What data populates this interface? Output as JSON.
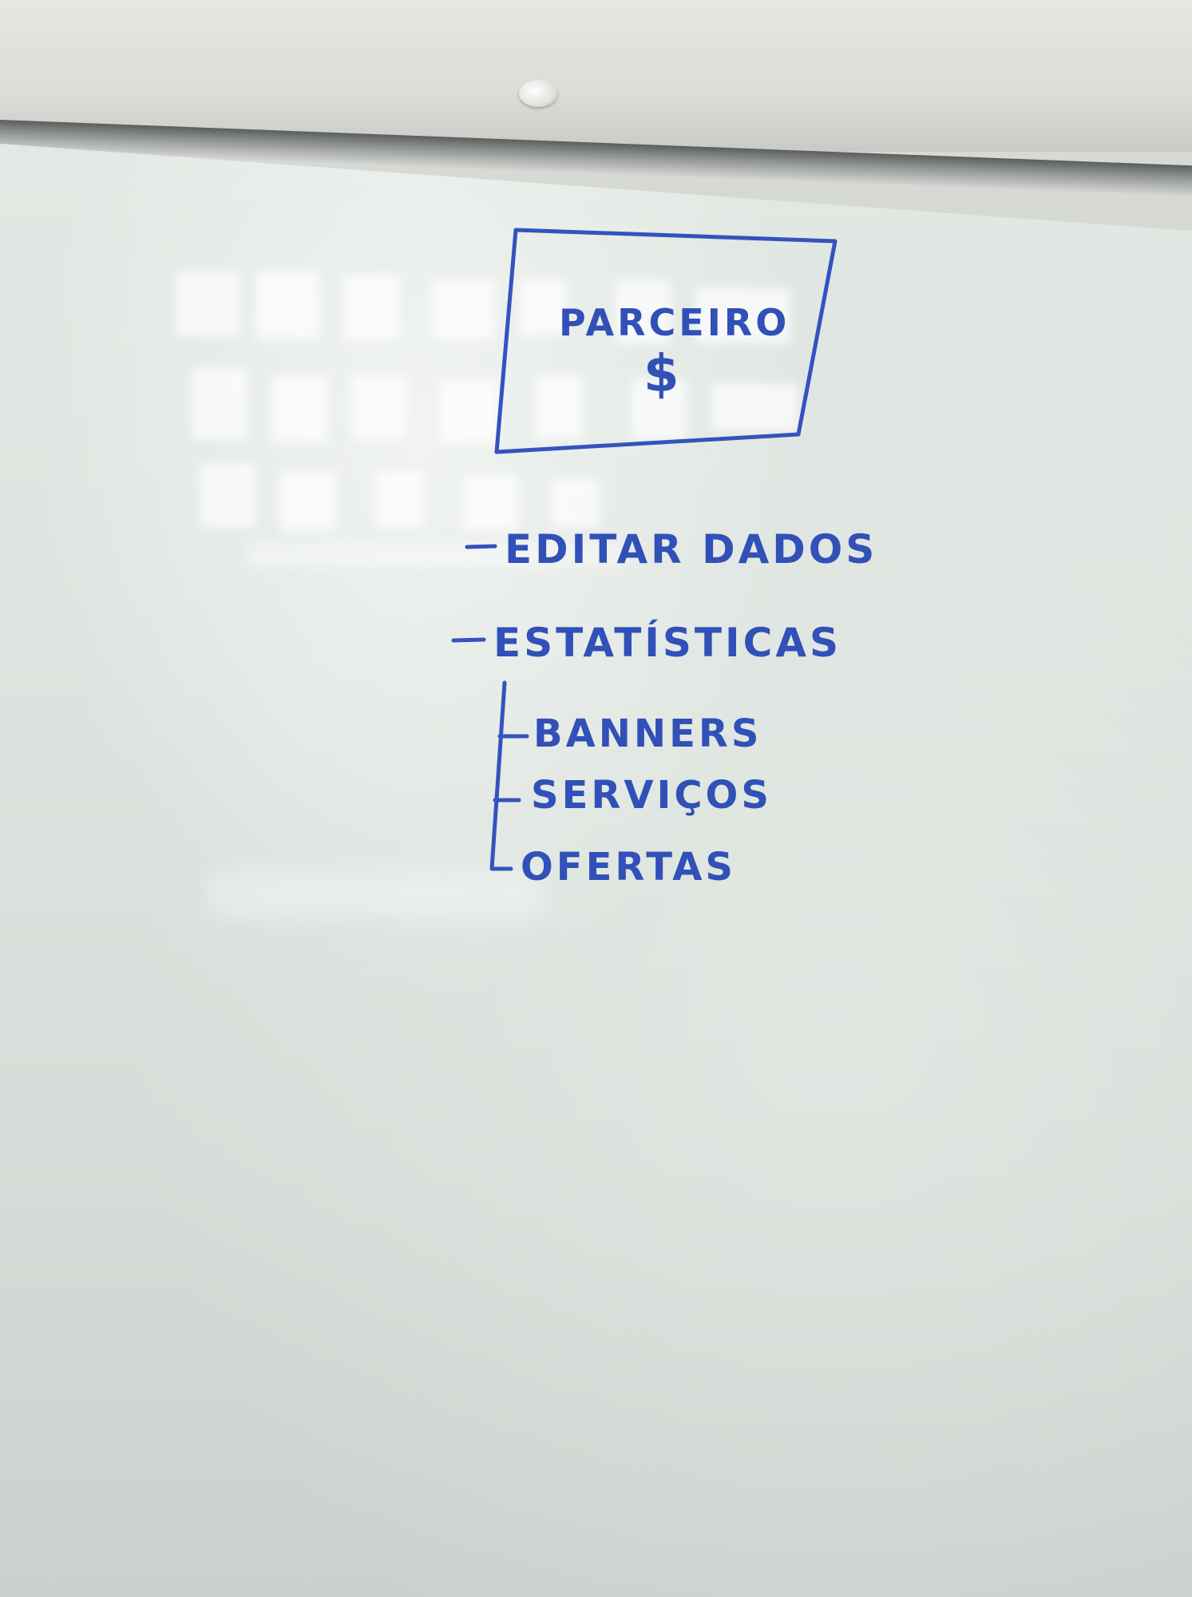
{
  "whiteboard": {
    "box": {
      "title": "PARCEIRO",
      "symbol": "$"
    },
    "items": [
      {
        "label": "EDITAR DADOS"
      },
      {
        "label": "ESTATÍSTICAS"
      }
    ],
    "subitems": [
      {
        "label": "BANNERS"
      },
      {
        "label": "SERVIÇOS"
      },
      {
        "label": "OFERTAS"
      }
    ],
    "ink_color": "#3150b8"
  }
}
